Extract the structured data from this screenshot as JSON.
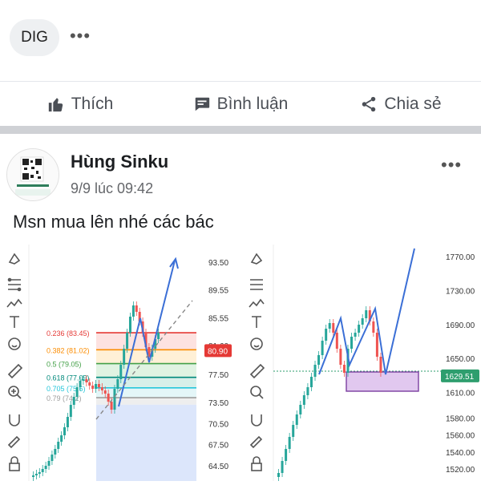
{
  "previous_post": {
    "tag_chip": "DIG",
    "more_label": "•••",
    "actions": {
      "like": "Thích",
      "comment": "Bình luận",
      "share": "Chia sẻ"
    }
  },
  "post": {
    "author": "Hùng Sinku",
    "timestamp": "9/9 lúc 09:42",
    "more_label": "•••",
    "text": "Msn mua lên nhé các bác"
  },
  "chart_data": [
    {
      "type": "candlestick",
      "title": "",
      "y_ticks": [
        "93.50",
        "89.55",
        "85.55",
        "81.60",
        "77.50",
        "73.50",
        "70.50",
        "67.50",
        "64.50"
      ],
      "current_price": "80.90",
      "fib_levels": [
        {
          "label": "0.236 (83.45)",
          "value": 83.45,
          "color": "#e53935"
        },
        {
          "label": "0.382 (81.02)",
          "value": 81.02,
          "color": "#fb8c00"
        },
        {
          "label": "0.5 (79.05)",
          "value": 79.05,
          "color": "#43a047"
        },
        {
          "label": "0.618 (77.09)",
          "value": 77.09,
          "color": "#00897b"
        },
        {
          "label": "0.705 (75.6)",
          "value": 75.6,
          "color": "#26c6da"
        },
        {
          "label": "0.79 (74.2)",
          "value": 74.2,
          "color": "#9e9e9e"
        }
      ]
    },
    {
      "type": "candlestick",
      "title": "",
      "y_ticks": [
        "1770.00",
        "1730.00",
        "1690.00",
        "1650.00",
        "1629.51",
        "1610.00",
        "1580.00",
        "1560.00",
        "1540.00",
        "1520.00"
      ],
      "current_price": "1629.51"
    }
  ]
}
